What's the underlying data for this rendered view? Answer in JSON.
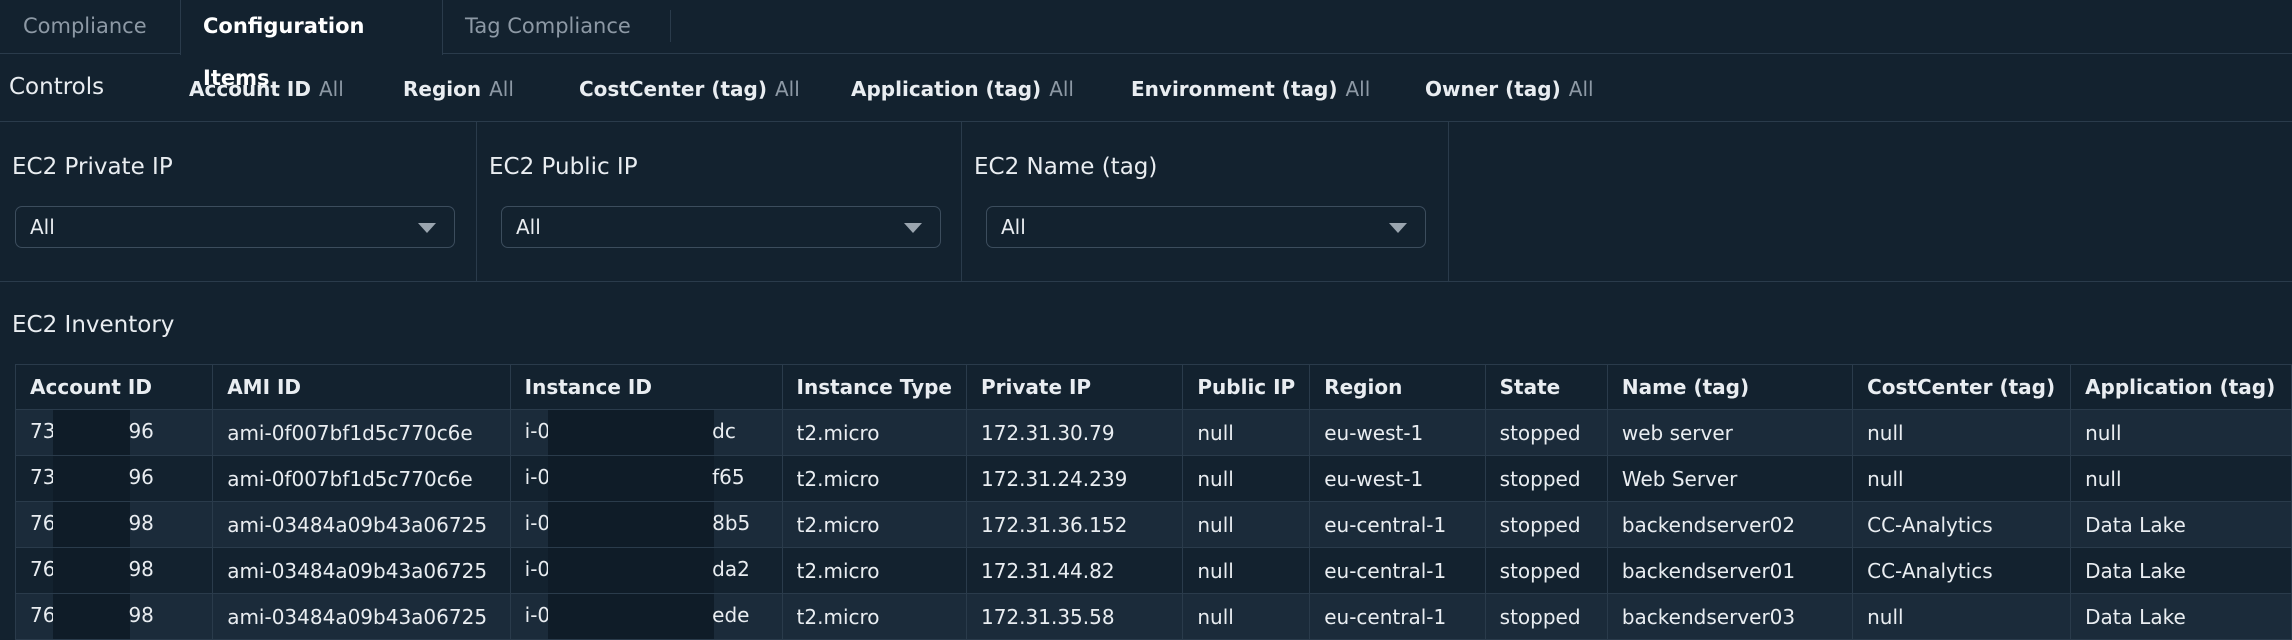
{
  "tabs": [
    {
      "label": "Compliance",
      "active": false
    },
    {
      "label": "Configuration Items",
      "active": true
    },
    {
      "label": "Tag Compliance",
      "active": false
    }
  ],
  "controls": {
    "title": "Controls",
    "items": [
      {
        "label": "Account ID",
        "value": "All"
      },
      {
        "label": "Region",
        "value": "All"
      },
      {
        "label": "CostCenter (tag)",
        "value": "All"
      },
      {
        "label": "Application (tag)",
        "value": "All"
      },
      {
        "label": "Environment (tag)",
        "value": "All"
      },
      {
        "label": "Owner (tag)",
        "value": "All"
      }
    ]
  },
  "filters": [
    {
      "label": "EC2 Private IP",
      "value": "All"
    },
    {
      "label": "EC2 Public IP",
      "value": "All"
    },
    {
      "label": "EC2 Name (tag)",
      "value": "All"
    }
  ],
  "inventory": {
    "title": "EC2 Inventory",
    "columns": [
      "Account ID",
      "AMI ID",
      "Instance ID",
      "Instance Type",
      "Private IP",
      "Public IP",
      "Region",
      "State",
      "Name (tag)",
      "CostCenter (tag)",
      "Application (tag)"
    ],
    "rows": [
      {
        "account_prefix": "73",
        "account_suffix": "96",
        "ami": "ami-0f007bf1d5c770c6e",
        "instance_prefix": "i-0",
        "instance_suffix": "dc",
        "type": "t2.micro",
        "private_ip": "172.31.30.79",
        "public_ip": "null",
        "region": "eu-west-1",
        "state": "stopped",
        "name": "web server",
        "costcenter": "null",
        "application": "null"
      },
      {
        "account_prefix": "73",
        "account_suffix": "96",
        "ami": "ami-0f007bf1d5c770c6e",
        "instance_prefix": "i-0",
        "instance_suffix": "f65",
        "type": "t2.micro",
        "private_ip": "172.31.24.239",
        "public_ip": "null",
        "region": "eu-west-1",
        "state": "stopped",
        "name": "Web Server",
        "costcenter": "null",
        "application": "null"
      },
      {
        "account_prefix": "76",
        "account_suffix": "98",
        "ami": "ami-03484a09b43a06725",
        "instance_prefix": "i-0",
        "instance_suffix": "8b5",
        "type": "t2.micro",
        "private_ip": "172.31.36.152",
        "public_ip": "null",
        "region": "eu-central-1",
        "state": "stopped",
        "name": "backendserver02",
        "costcenter": "CC-Analytics",
        "application": "Data Lake"
      },
      {
        "account_prefix": "76",
        "account_suffix": "98",
        "ami": "ami-03484a09b43a06725",
        "instance_prefix": "i-0",
        "instance_suffix": "da2",
        "type": "t2.micro",
        "private_ip": "172.31.44.82",
        "public_ip": "null",
        "region": "eu-central-1",
        "state": "stopped",
        "name": "backendserver01",
        "costcenter": "CC-Analytics",
        "application": "Data Lake"
      },
      {
        "account_prefix": "76",
        "account_suffix": "98",
        "ami": "ami-03484a09b43a06725",
        "instance_prefix": "i-0",
        "instance_suffix": "ede",
        "type": "t2.micro",
        "private_ip": "172.31.35.58",
        "public_ip": "null",
        "region": "eu-central-1",
        "state": "stopped",
        "name": "backendserver03",
        "costcenter": "null",
        "application": "Data Lake"
      }
    ]
  }
}
